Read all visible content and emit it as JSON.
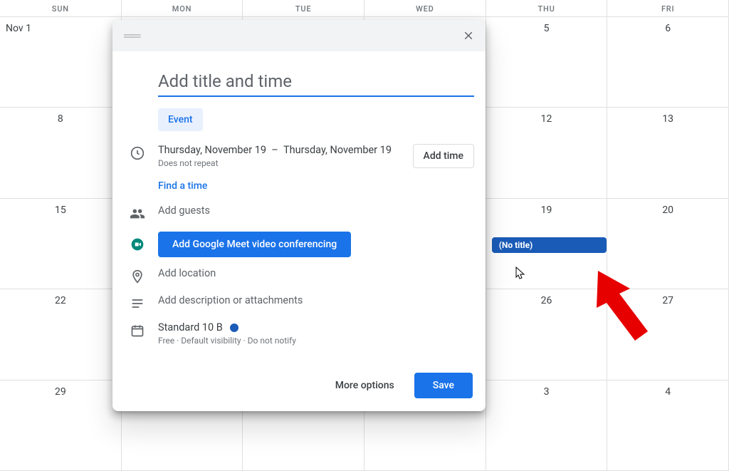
{
  "calendar": {
    "days_header": [
      "SUN",
      "MON",
      "TUE",
      "WED",
      "THU",
      "FRI"
    ],
    "weeks": [
      [
        "Nov 1",
        "",
        "",
        "",
        "5",
        "6"
      ],
      [
        "8",
        "",
        "",
        "",
        "12",
        "13"
      ],
      [
        "15",
        "",
        "",
        "",
        "19",
        "20"
      ],
      [
        "22",
        "",
        "",
        "",
        "26",
        "27"
      ],
      [
        "29",
        "",
        "",
        "",
        "3",
        "4"
      ]
    ],
    "event_chip": {
      "label": "(No title)"
    }
  },
  "modal": {
    "title_placeholder": "Add title and time",
    "tab_event": "Event",
    "date_start": "Thursday, November 19",
    "date_sep": "–",
    "date_end": "Thursday, November 19",
    "repeat_text": "Does not repeat",
    "add_time_btn": "Add time",
    "find_time_link": "Find a time",
    "add_guests": "Add guests",
    "meet_btn": "Add Google Meet video conferencing",
    "add_location": "Add location",
    "add_description": "Add description or attachments",
    "calendar_name": "Standard 10 B",
    "calendar_sub": "Free · Default visibility · Do not notify",
    "more_options": "More options",
    "save": "Save"
  }
}
